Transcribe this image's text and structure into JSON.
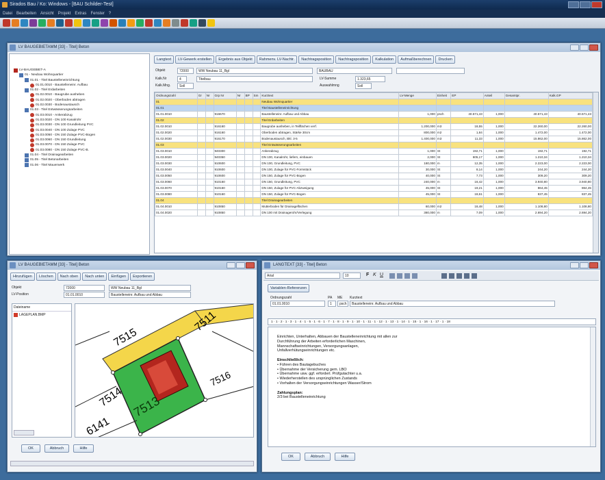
{
  "app": {
    "title": "Sirados Bau / Ko: Windows - [BAU Schilder-Test]",
    "menu": [
      "Datei",
      "Bearbeiten",
      "Ansicht",
      "Projekt",
      "Extras",
      "Fenster",
      "?"
    ]
  },
  "tree_window": {
    "title": "LV BAUGEBIETAMM [33] - Titel] Beton",
    "nodes": [
      {
        "label": "LV-BAUGEBIET-A",
        "depth": 0
      },
      {
        "label": "01 - Neubau Wohnquartier",
        "depth": 1
      },
      {
        "label": "01.01 - Titel Baustelleneinrichtung",
        "depth": 2
      },
      {
        "label": "01.01.0010 - Baustelleneinr. Aufbau",
        "depth": 3
      },
      {
        "label": "01.02 - Titel Erdarbeiten",
        "depth": 2
      },
      {
        "label": "01.02.0010 - Baugrube ausheben",
        "depth": 3
      },
      {
        "label": "01.02.0020 - Oberboden abtragen",
        "depth": 3
      },
      {
        "label": "01.02.0030 - Bodenaustausch",
        "depth": 3
      },
      {
        "label": "01.03 - Titel Entwässerungsarbeiten",
        "depth": 2
      },
      {
        "label": "01.03.0010 - Ankerabzug",
        "depth": 3
      },
      {
        "label": "01.03.0020 - DN 100 Kanalrohr",
        "depth": 3
      },
      {
        "label": "01.03.0030 - DN 100 Grundleitung PVC",
        "depth": 3
      },
      {
        "label": "01.03.0040 - DN 100 Zulage PVC",
        "depth": 3
      },
      {
        "label": "01.03.0050 - DN 150 Zulage PVC-Bogen",
        "depth": 3
      },
      {
        "label": "01.03.0060 - DN 150 Grundleitung",
        "depth": 3
      },
      {
        "label": "01.03.0070 - DN 150 Zulage PVC",
        "depth": 3
      },
      {
        "label": "01.03.0080 - DN 150 Zulage PVC-B.",
        "depth": 3
      },
      {
        "label": "01.04 - Titel Drainagearbeiten",
        "depth": 2
      },
      {
        "label": "01.05 - Titel Betonarbeiten",
        "depth": 2
      },
      {
        "label": "01.06 - Titel Mauerwerk",
        "depth": 2
      }
    ]
  },
  "table_panel": {
    "buttons": [
      "Langtext",
      "LV-Gewerk erstellen",
      "Ergebnis aus Objekt",
      "Rahmenv. LV-Nachtr.",
      "Nachtragsposition",
      "Nachtragsposition",
      "Kalkulation",
      "Aufmaßberechnen",
      "Drucken"
    ],
    "header": {
      "objekt_label": "Objekt",
      "objekt_nr": "72000",
      "objekt_name": "WW Neubau 11_Bgl",
      "bauherr": "BAUBAU",
      "kalk_label": "Kalk.Nr",
      "kalk_nr": "4",
      "kalk_name": "Titelbau",
      "lv_label": "Kalk.Mng.",
      "lv_val": "Soll",
      "gesamt_label": "LV-Summe",
      "gesamt_val": "1.323,65",
      "angebot_label": "Auswahlmng",
      "angebot_val": "Soll"
    },
    "columns": [
      "Ordnungszahl",
      "Gr",
      "Nr",
      "Grp Nr",
      "Nr",
      "BP",
      "Sm",
      "Kurztext",
      "LV-Menge",
      "Einheit",
      "EP",
      "Anteil",
      "Gesamtpr.",
      "Kalk.GP"
    ],
    "rows": [
      {
        "oz": "01",
        "grp": "",
        "kt": "Neubau Wohnquartier",
        "m": "",
        "e": "",
        "ep": "",
        "a": "",
        "gp": "",
        "kgp": "",
        "t": "y"
      },
      {
        "oz": "01.01",
        "grp": "",
        "kt": "Titel Baustelleneinrichtung",
        "m": "",
        "e": "",
        "ep": "",
        "a": "",
        "gp": "",
        "kgp": "",
        "t": "sel"
      },
      {
        "oz": "01.01.0010",
        "grp": "916670",
        "kt": "Baustelleneinr. Aufbau und Abbau",
        "m": "1,000",
        "e": "psch",
        "ep": "40.571,43",
        "a": "1,000",
        "gp": "40.571,43",
        "kgp": "40.571,43",
        "t": ""
      },
      {
        "oz": "01.02",
        "grp": "",
        "kt": "Titel Erdarbeiten",
        "m": "",
        "e": "",
        "ep": "",
        "a": "",
        "gp": "",
        "kgp": "",
        "t": "y"
      },
      {
        "oz": "01.02.0010",
        "grp": "916160",
        "kt": "Baugrube ausheben, in Teilflächen verf.",
        "m": "1.200,000",
        "e": "m3",
        "ep": "18,55",
        "a": "1,000",
        "gp": "22.260,00",
        "kgp": "22.260,00",
        "t": ""
      },
      {
        "oz": "01.02.0020",
        "grp": "916160",
        "kt": "Oberboden abtragen, Stärke 30cm",
        "m": "800,000",
        "e": "m2",
        "ep": "1,84",
        "a": "1,000",
        "gp": "1.472,00",
        "kgp": "1.472,00",
        "t": ""
      },
      {
        "oz": "01.02.0030",
        "grp": "916170",
        "kt": "Bodenaustausch, Bkl. 3-5",
        "m": "1.400,000",
        "e": "m3",
        "ep": "11,33",
        "a": "1,000",
        "gp": "15.862,00",
        "kgp": "15.862,00",
        "t": ""
      },
      {
        "oz": "01.03",
        "grp": "",
        "kt": "Titel Entwässerungsarbeiten",
        "m": "",
        "e": "",
        "ep": "",
        "a": "",
        "gp": "",
        "kgp": "",
        "t": "y"
      },
      {
        "oz": "01.03.0010",
        "grp": "940300",
        "kt": "Ankerabzug",
        "m": "1,000",
        "e": "St",
        "ep": "192,71",
        "a": "1,000",
        "gp": "192,71",
        "kgp": "192,71",
        "t": ""
      },
      {
        "oz": "01.03.0020",
        "grp": "940350",
        "kt": "DN 100, Kanalrohr, liefern, einbauen",
        "m": "2,000",
        "e": "St",
        "ep": "605,17",
        "a": "1,000",
        "gp": "1.210,34",
        "kgp": "1.210,34",
        "t": ""
      },
      {
        "oz": "01.03.0030",
        "grp": "910600",
        "kt": "DN 100, Grundleitung, PVC",
        "m": "180,000",
        "e": "m",
        "ep": "12,35",
        "a": "1,000",
        "gp": "2.223,00",
        "kgp": "2.223,00",
        "t": ""
      },
      {
        "oz": "01.03.0040",
        "grp": "910600",
        "kt": "DN 100, Zulage für PVC-Formstück",
        "m": "30,000",
        "e": "St",
        "ep": "8,14",
        "a": "1,000",
        "gp": "244,20",
        "kgp": "244,20",
        "t": ""
      },
      {
        "oz": "01.03.0050",
        "grp": "910600",
        "kt": "DN 150, Zulage für PVC-Bogen",
        "m": "40,000",
        "e": "St",
        "ep": "7,73",
        "a": "1,000",
        "gp": "309,20",
        "kgp": "309,20",
        "t": ""
      },
      {
        "oz": "01.03.0060",
        "grp": "910160",
        "kt": "DN 150, Grundleitung, PVC",
        "m": "240,000",
        "e": "m",
        "ep": "16,42",
        "a": "1,000",
        "gp": "3.940,80",
        "kgp": "3.940,80",
        "t": ""
      },
      {
        "oz": "01.03.0070",
        "grp": "910160",
        "kt": "DN 150, Zulage für PVC-Abzweigung",
        "m": "45,000",
        "e": "St",
        "ep": "19,21",
        "a": "1,000",
        "gp": "864,45",
        "kgp": "864,45",
        "t": ""
      },
      {
        "oz": "01.03.0080",
        "grp": "910160",
        "kt": "DN 150, Zulage für PVC-Bogen",
        "m": "45,000",
        "e": "St",
        "ep": "18,61",
        "a": "1,000",
        "gp": "837,45",
        "kgp": "837,45",
        "t": ""
      },
      {
        "oz": "01.04",
        "grp": "",
        "kt": "Titel Drainagearbeiten",
        "m": "",
        "e": "",
        "ep": "",
        "a": "",
        "gp": "",
        "kgp": "",
        "t": "y"
      },
      {
        "oz": "01.04.0010",
        "grp": "910850",
        "kt": "Mutterboden für Drainageflächen",
        "m": "60,000",
        "e": "m2",
        "ep": "18,48",
        "a": "1,000",
        "gp": "1.108,80",
        "kgp": "1.108,80",
        "t": ""
      },
      {
        "oz": "01.04.0020",
        "grp": "910850",
        "kt": "DN 100 mit Drainagerohr/Verlegung",
        "m": "380,000",
        "e": "m",
        "ep": "7,09",
        "a": "1,000",
        "gp": "2.694,20",
        "kgp": "2.694,20",
        "t": ""
      }
    ]
  },
  "image_window": {
    "title": "LV BAUGEBIETAMM [33] - Titel] Beton",
    "buttons": [
      "Hinzufügen",
      "Löschen",
      "Nach oben",
      "Nach unten",
      "Einfügen",
      "Exportieren"
    ],
    "objekt_label": "Objekt",
    "objekt_val": "72000",
    "objekt_name": "WW Neubau 11_Bgl",
    "pos_label": "LV-Position",
    "pos_val": "01.01.0010",
    "pos_text": "Baustelleneinr. Aufbau und Abbau",
    "list_label": "Dateiname",
    "file": "LAGEPLAN.BMP",
    "ok": "OK",
    "abbruch": "Abbruch",
    "hilfe": "Hilfe",
    "plan_labels": [
      "7515",
      "7514",
      "7513",
      "7511",
      "7516",
      "6141"
    ]
  },
  "text_window": {
    "title": "LANGTEXT [33] - Titel] Beton",
    "font": "Arial",
    "size": "10",
    "var_button": "Variablen-Referenzen",
    "oz_label": "Ordnungszahl",
    "oz_val": "01.01.0010",
    "menge_label": "PA",
    "menge_val": "1",
    "einheit_label": "ME",
    "einheit_val": "psch",
    "kurz_label": "Kurztext",
    "kurz_val": "Baustelleneinr. Aufbau und Abbau",
    "ruler": "1 · 1 · 2 · 1 · 3 · 1 · 4 · 1 · 5 · 1 · 6 · 1 · 7 · 1 · 8 · 1 · 9 · 1 · 10 · 1 · 11 · 1 · 12 · 1 · 13 · 1 · 14 · 1 · 15 · 1 · 16 · 1 · 17 · 1 · 18",
    "lines": [
      "Einrichten, Unterhalten, Abbauen der Baustelleneinrichtung mit allen zur",
      "Durchführung der Arbeiten erforderlichen Maschinen,",
      "Mannschaftseinrichtungen, Versorgungsanlagen,",
      "Unfallverhütungseinrichtungen etc.",
      "",
      "Einschließlich:",
      "•    Führen des Bautagebuches",
      "•    Übernahme der Versicherung gem. LBO",
      "•    Übernahme usw. ggf. erforderl. Prüfgutachter u.a.",
      "•    Wiederherstellen des ursprünglichen Zustands",
      "•    Vorhalten der Versorgungseinrichtungen Wasser/Strom",
      "",
      "Zahlungsplan:",
      "2/3 bei Baustelleneinrichtung"
    ],
    "ok": "OK",
    "abbruch": "Abbruch",
    "hilfe": "Hilfe"
  }
}
